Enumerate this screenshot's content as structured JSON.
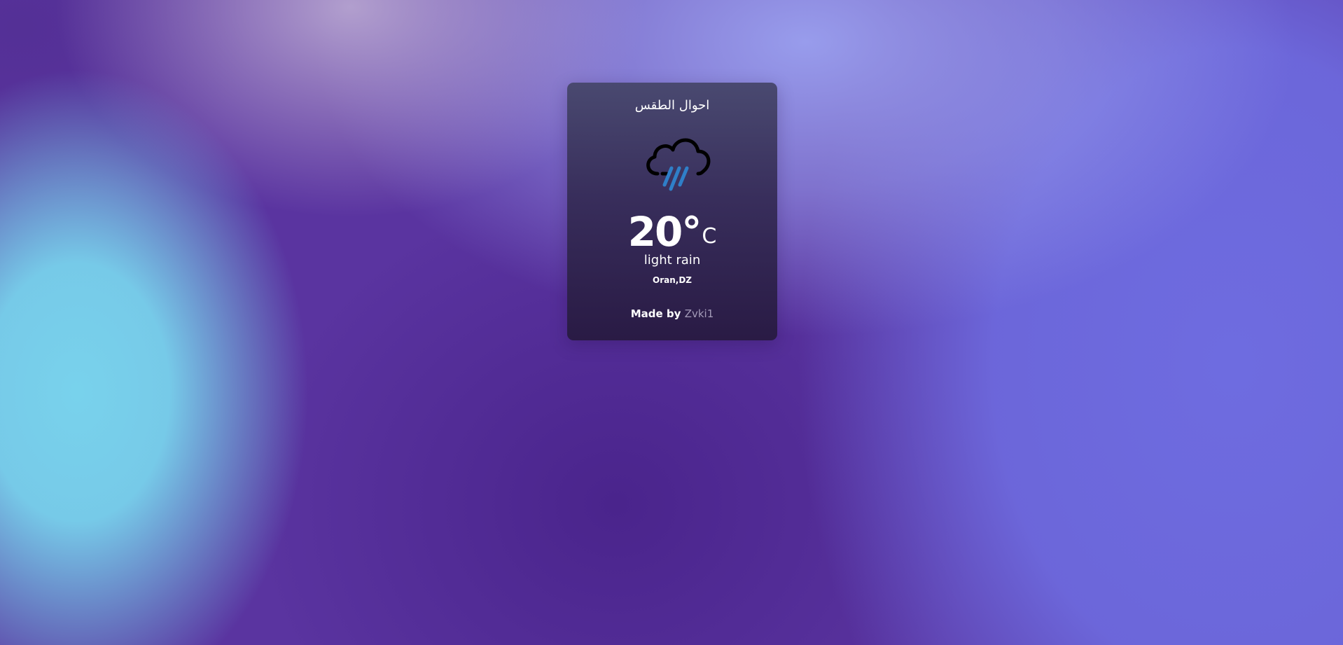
{
  "card": {
    "title": "احوال الطقس",
    "icon": "cloud-rain-icon",
    "temperature": "20°",
    "unit": "C",
    "description": "light rain",
    "location": "Oran,DZ",
    "credit_prefix": "Made by",
    "credit_author": "Zvki1"
  },
  "colors": {
    "cloud_outline": "#000000",
    "rain": "#2f7fc8",
    "text": "#ffffff",
    "author_link": "#a49bb8"
  }
}
